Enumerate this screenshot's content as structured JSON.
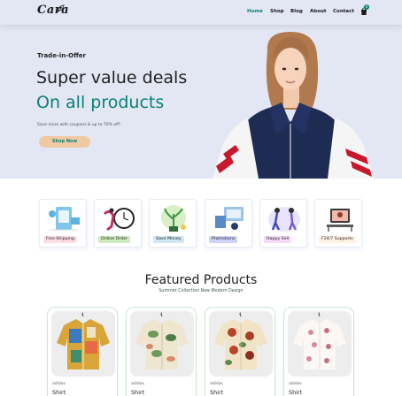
{
  "header": {
    "logo": "Cara",
    "nav": [
      {
        "label": "Home",
        "active": true
      },
      {
        "label": "Shop",
        "active": false
      },
      {
        "label": "Blog",
        "active": false
      },
      {
        "label": "About",
        "active": false
      },
      {
        "label": "Contact",
        "active": false
      }
    ],
    "cart_count": "0",
    "cart_icon": "shopping-bag-icon"
  },
  "hero": {
    "subtitle": "Trade-in-Offer",
    "headline": "Super value deals",
    "headline_accent": "On all products",
    "description": "Save more with coupons & up to 70% off!",
    "button_label": "Shop Now"
  },
  "features": [
    {
      "label": "Free Shipping",
      "color": "#fddde4"
    },
    {
      "label": "Online Order",
      "color": "#cdebbc"
    },
    {
      "label": "Save Money",
      "color": "#d1e8f2"
    },
    {
      "label": "Promotions",
      "color": "#cdd4f8"
    },
    {
      "label": "Happy Sell",
      "color": "#f6dbf6"
    },
    {
      "label": "F24/7 Supports",
      "color": "#fff2e5"
    }
  ],
  "featured": {
    "title": "Featured Products",
    "subtitle": "Summer Collection New Modern Design"
  },
  "products": [
    {
      "brand": "adidas",
      "name": "Shirt"
    },
    {
      "brand": "adidas",
      "name": "Shirt"
    },
    {
      "brand": "adidas",
      "name": "Shirt"
    },
    {
      "brand": "adidas",
      "name": "Shirt"
    }
  ],
  "colors": {
    "accent": "#088178",
    "hero_bg": "#e3e6f3",
    "button_bg": "#f0c9a4"
  }
}
